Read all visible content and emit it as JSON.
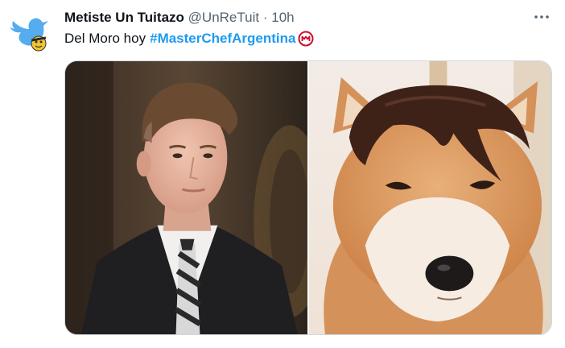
{
  "tweet": {
    "display_name": "Metiste Un Tuitazo",
    "handle": "@UnReTuit",
    "separator": "·",
    "time": "10h",
    "text": "Del Moro hoy",
    "hashtag": "#MasterChefArgentina",
    "emoji_icon": "masterchef-logo-icon",
    "more_icon": "more-options-icon",
    "avatar_icon": "twitter-bird-avatar-icon"
  },
  "colors": {
    "hashtag": "#1d9bf0",
    "meta": "#536471",
    "text": "#0f1419",
    "emoji_ring": "#c8102e"
  },
  "media": [
    {
      "name": "photo-man-in-suit"
    },
    {
      "name": "photo-shiba-dog-with-hair"
    }
  ]
}
